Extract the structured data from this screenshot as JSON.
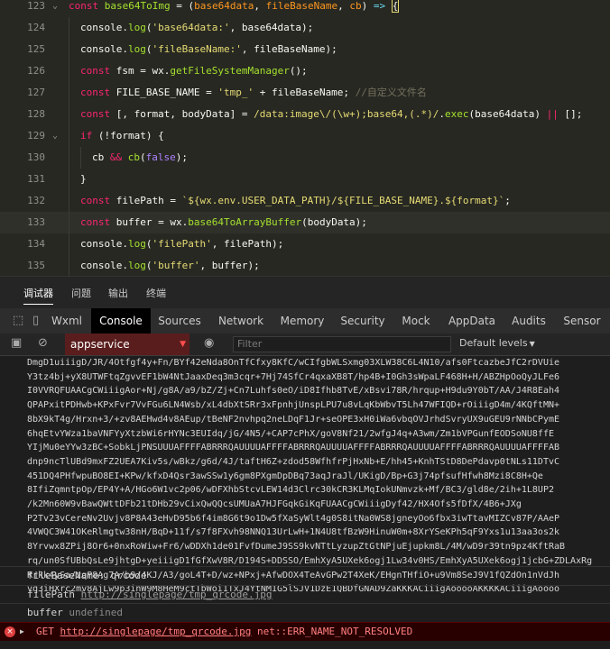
{
  "editor": {
    "lines": [
      {
        "num": "123",
        "fold": "⌄"
      },
      {
        "num": "124",
        "fold": ""
      },
      {
        "num": "125",
        "fold": ""
      },
      {
        "num": "126",
        "fold": ""
      },
      {
        "num": "127",
        "fold": ""
      },
      {
        "num": "128",
        "fold": ""
      },
      {
        "num": "129",
        "fold": "⌄"
      },
      {
        "num": "130",
        "fold": ""
      },
      {
        "num": "131",
        "fold": ""
      },
      {
        "num": "132",
        "fold": ""
      },
      {
        "num": "133",
        "fold": ""
      },
      {
        "num": "134",
        "fold": ""
      },
      {
        "num": "135",
        "fold": ""
      }
    ],
    "tokens": [
      [
        [
          "k",
          "const "
        ],
        [
          "f",
          "base64ToImg"
        ],
        [
          "w",
          " = ("
        ],
        [
          "p",
          "base64data"
        ],
        [
          "w",
          ", "
        ],
        [
          "p",
          "fileBaseName"
        ],
        [
          "w",
          ", "
        ],
        [
          "p",
          "cb"
        ],
        [
          "w",
          ") "
        ],
        [
          "kw",
          "=>"
        ],
        [
          "w",
          " "
        ],
        [
          "b",
          "{"
        ]
      ],
      [
        [
          "w",
          "console."
        ],
        [
          "f",
          "log"
        ],
        [
          "w",
          "("
        ],
        [
          "s",
          "'base64data:'"
        ],
        [
          "w",
          ", base64data);"
        ]
      ],
      [
        [
          "w",
          "console."
        ],
        [
          "f",
          "log"
        ],
        [
          "w",
          "("
        ],
        [
          "s",
          "'fileBaseName:'"
        ],
        [
          "w",
          ", fileBaseName);"
        ]
      ],
      [
        [
          "k",
          "const "
        ],
        [
          "w",
          "fsm = wx."
        ],
        [
          "f",
          "getFileSystemManager"
        ],
        [
          "w",
          "();"
        ]
      ],
      [
        [
          "k",
          "const "
        ],
        [
          "w",
          "FILE_BASE_NAME = "
        ],
        [
          "s",
          "'tmp_'"
        ],
        [
          "w",
          " + fileBaseName; "
        ],
        [
          "c",
          "//自定义文件名"
        ]
      ],
      [
        [
          "k",
          "const "
        ],
        [
          "w",
          "[, format, bodyData] = "
        ],
        [
          "r",
          "/data:image\\/(\\w+);base64,(.*)/"
        ],
        [
          "w",
          "."
        ],
        [
          "f",
          "exec"
        ],
        [
          "w",
          "(base64data) "
        ],
        [
          "o",
          "||"
        ],
        [
          "w",
          " [];"
        ]
      ],
      [
        [
          "k",
          "if "
        ],
        [
          "w",
          "(!format) {"
        ]
      ],
      [
        [
          "w",
          "cb "
        ],
        [
          "o",
          "&&"
        ],
        [
          "w",
          " "
        ],
        [
          "f",
          "cb"
        ],
        [
          "w",
          "("
        ],
        [
          "n",
          "false"
        ],
        [
          "w",
          ");"
        ]
      ],
      [
        [
          "w",
          "}"
        ]
      ],
      [
        [
          "k",
          "const "
        ],
        [
          "w",
          "filePath = "
        ],
        [
          "s",
          "`${wx.env.USER_DATA_PATH}/${FILE_BASE_NAME}.${format}`"
        ],
        [
          "w",
          ";"
        ]
      ],
      [
        [
          "k",
          "const "
        ],
        [
          "w",
          "buffer = wx."
        ],
        [
          "f",
          "base64ToArrayBuffer"
        ],
        [
          "w",
          "(bodyData);"
        ]
      ],
      [
        [
          "w",
          "console."
        ],
        [
          "f",
          "log"
        ],
        [
          "w",
          "("
        ],
        [
          "s",
          "'filePath'"
        ],
        [
          "w",
          ", filePath);"
        ]
      ],
      [
        [
          "w",
          "console."
        ],
        [
          "f",
          "log"
        ],
        [
          "w",
          "("
        ],
        [
          "s",
          "'buffer'"
        ],
        [
          "w",
          ", buffer);"
        ]
      ]
    ]
  },
  "panel_tabs": [
    "调试器",
    "问题",
    "输出",
    "终端"
  ],
  "devtools_tabs": [
    "Wxml",
    "Console",
    "Sources",
    "Network",
    "Memory",
    "Security",
    "Mock",
    "AppData",
    "Audits",
    "Sensor"
  ],
  "active_devtools_tab": "Console",
  "toolbar": {
    "context": "appservice",
    "filter_placeholder": "Filter",
    "levels": "Default levels"
  },
  "console": {
    "base64_lines": [
      "DmgD1uiiigD/JR/4Otfgf4y+Fn/BYf42eNda8OnTfCfxy8KfC/wCIfgbWLSxmg03XLW38C6L4N10/afs0FtcazbeJfC2rDVUie",
      "Y3tz4bj+yX8UTWFtqZgvvEF1bW4NtJaaxDeq3m3cqr+7Hj74SfCr4qxaXB8T/hp4B+I0Gh3sWpaLF468H+H/ABZHpOoQyJLFe6",
      "I0VVRQFUAACgCWiiigAor+Nj/g8A/a9/bZ/Zj+Cn7Luhfs0eO/iD8Ifhb8TvE/xBsvi78R/hrqup+H9du9Y0bT/AA/J4R8Eah4",
      "QPAPxitPDHwb+KPxFvr7VvFGu6LN4Wsb/xL4dbXtSRr3xFpnhjUnspLPU7u8vLqKbWbvT5Lh47WFIQD+rOiiigD4m/4KQftMN+",
      "8bX9kT4g/Hrxn+3/+zv8AEHwd4v8AEup/tBeNF2nvhpq2neLDqF1Jr+seOPE3xH0iWa6vbqOVJrhdSvryUX9uGEU9rNNbCPymE",
      "6hqEtvYWza1baVNFYyXtzbWi6rHYNc3EUIdq/jG/4N5/+CAP7cPhX/goV8Nf21/2wfgJ4q+A3wm/Zm1bVPGunfEODSoNU8ffE",
      "YIjMu0eYYw3zBC+SobkLjPNSUUUAFFFFABRRRQAUUUUAFFFFABRRRQAUUUUAFFFFABRRRQAUUUUAFFFFABRRRQAUUUUAFFFFAB",
      "dnp9ncTlUBd9mxFZ2UEA7Kiv5s/wBkz/g6d/4J/taftH6Z+zdod58WfhfrPjHxNb+E/hh45+KnhTStD8DePdavp0tNLs11DTvC",
      "451DQ4PHfwpuBO8EI+KPw/kfxD4Qsr3awSSw1y6gm8PXgmDpDBq73aqJraJl/UKigD/Bp+G3j74pfsufHfwh8Mzi8C8H+Qe",
      "8IfiZqmntpOp/EP4Y+A/HGo6W1vc2p06/wDFXhbStcvLEW14d3Clrc30kCR3KLMqIokUNmvzk+Mf/BC3/gld8e/2ih+1L8UP2",
      "/k2Mn60W9vBawQWttDFb21tDHb29vCixQwQQcsUMUaA7HJFGqkGiKqFUAACgCWiiigDyf42/HX4Ofs5fDfX/4B6+JXg",
      "P2Tv23vCereNv2Uvjv8P8A43eHvD95b6f4im8G6t9o1Dw5fXaSyWlt4g0S8itNa0WS8jgneyOo6fbx3iwTtavMIZCv87P/AAeP",
      "4VWQC3W41OKeRlmgtw38nH/BqD+11f/s7f8FXvh98NNQ13UrLwH+1N4U8tfBzW9HinuW0m+8XrYSeKPh5qF9Yxs1u13aa3os2k",
      "8Yrvwx8ZPij8Or6+0nxRoWiw+Fr6/wDDXh1de01FvfDumeJ9SS9kvNTtLyzupZtGtNPjuEjupkm8L/4M/wD9r39tn9pz4KftRaB",
      "rq/un0SfUBbQsLe9jhtgD+yeiiigD1fGfXwV8R/D194S+DDSSO/EmhXyA5UXek6ogj1Lw34v0HS/EmhXyA5UXek6ogj1jcbG+ZDLAxRg",
      "Rrkk4ySa/zqP8Ag7A/b9/4KJ/A3/goL4T+D/wz+NPxj+AfwDOX4TeAvGPw2T4XeK/EHgnTHfiO+u9Vm8SeJ9V1fQZdOn1nVdJh",
      "vq3iHXrc2mv8AjLw9p3inW9M8HeM9ctTbWoi1TxJ4YtNM1G5lSJV1DzE1QBDfGNAD9ZaKKKACiiigAooooAKKKKACiiigAoooo"
    ],
    "messages": [
      {
        "label": "fileBaseName:",
        "value": "qrcode"
      },
      {
        "label": "filePath",
        "value": "http://singlepage/tmp_qrcode.jpg"
      },
      {
        "label": "buffer",
        "value": "undefined"
      }
    ],
    "error": {
      "method": "GET",
      "url": "http://singlepage/tmp_qrcode.jpg",
      "message": "net::ERR_NAME_NOT_RESOLVED",
      "badge": "×",
      "arrow": "▶"
    }
  },
  "icons": {
    "inspect": "⬚",
    "device": "▯",
    "sidebar": "▣",
    "clear": "⊘",
    "eye": "◉"
  }
}
